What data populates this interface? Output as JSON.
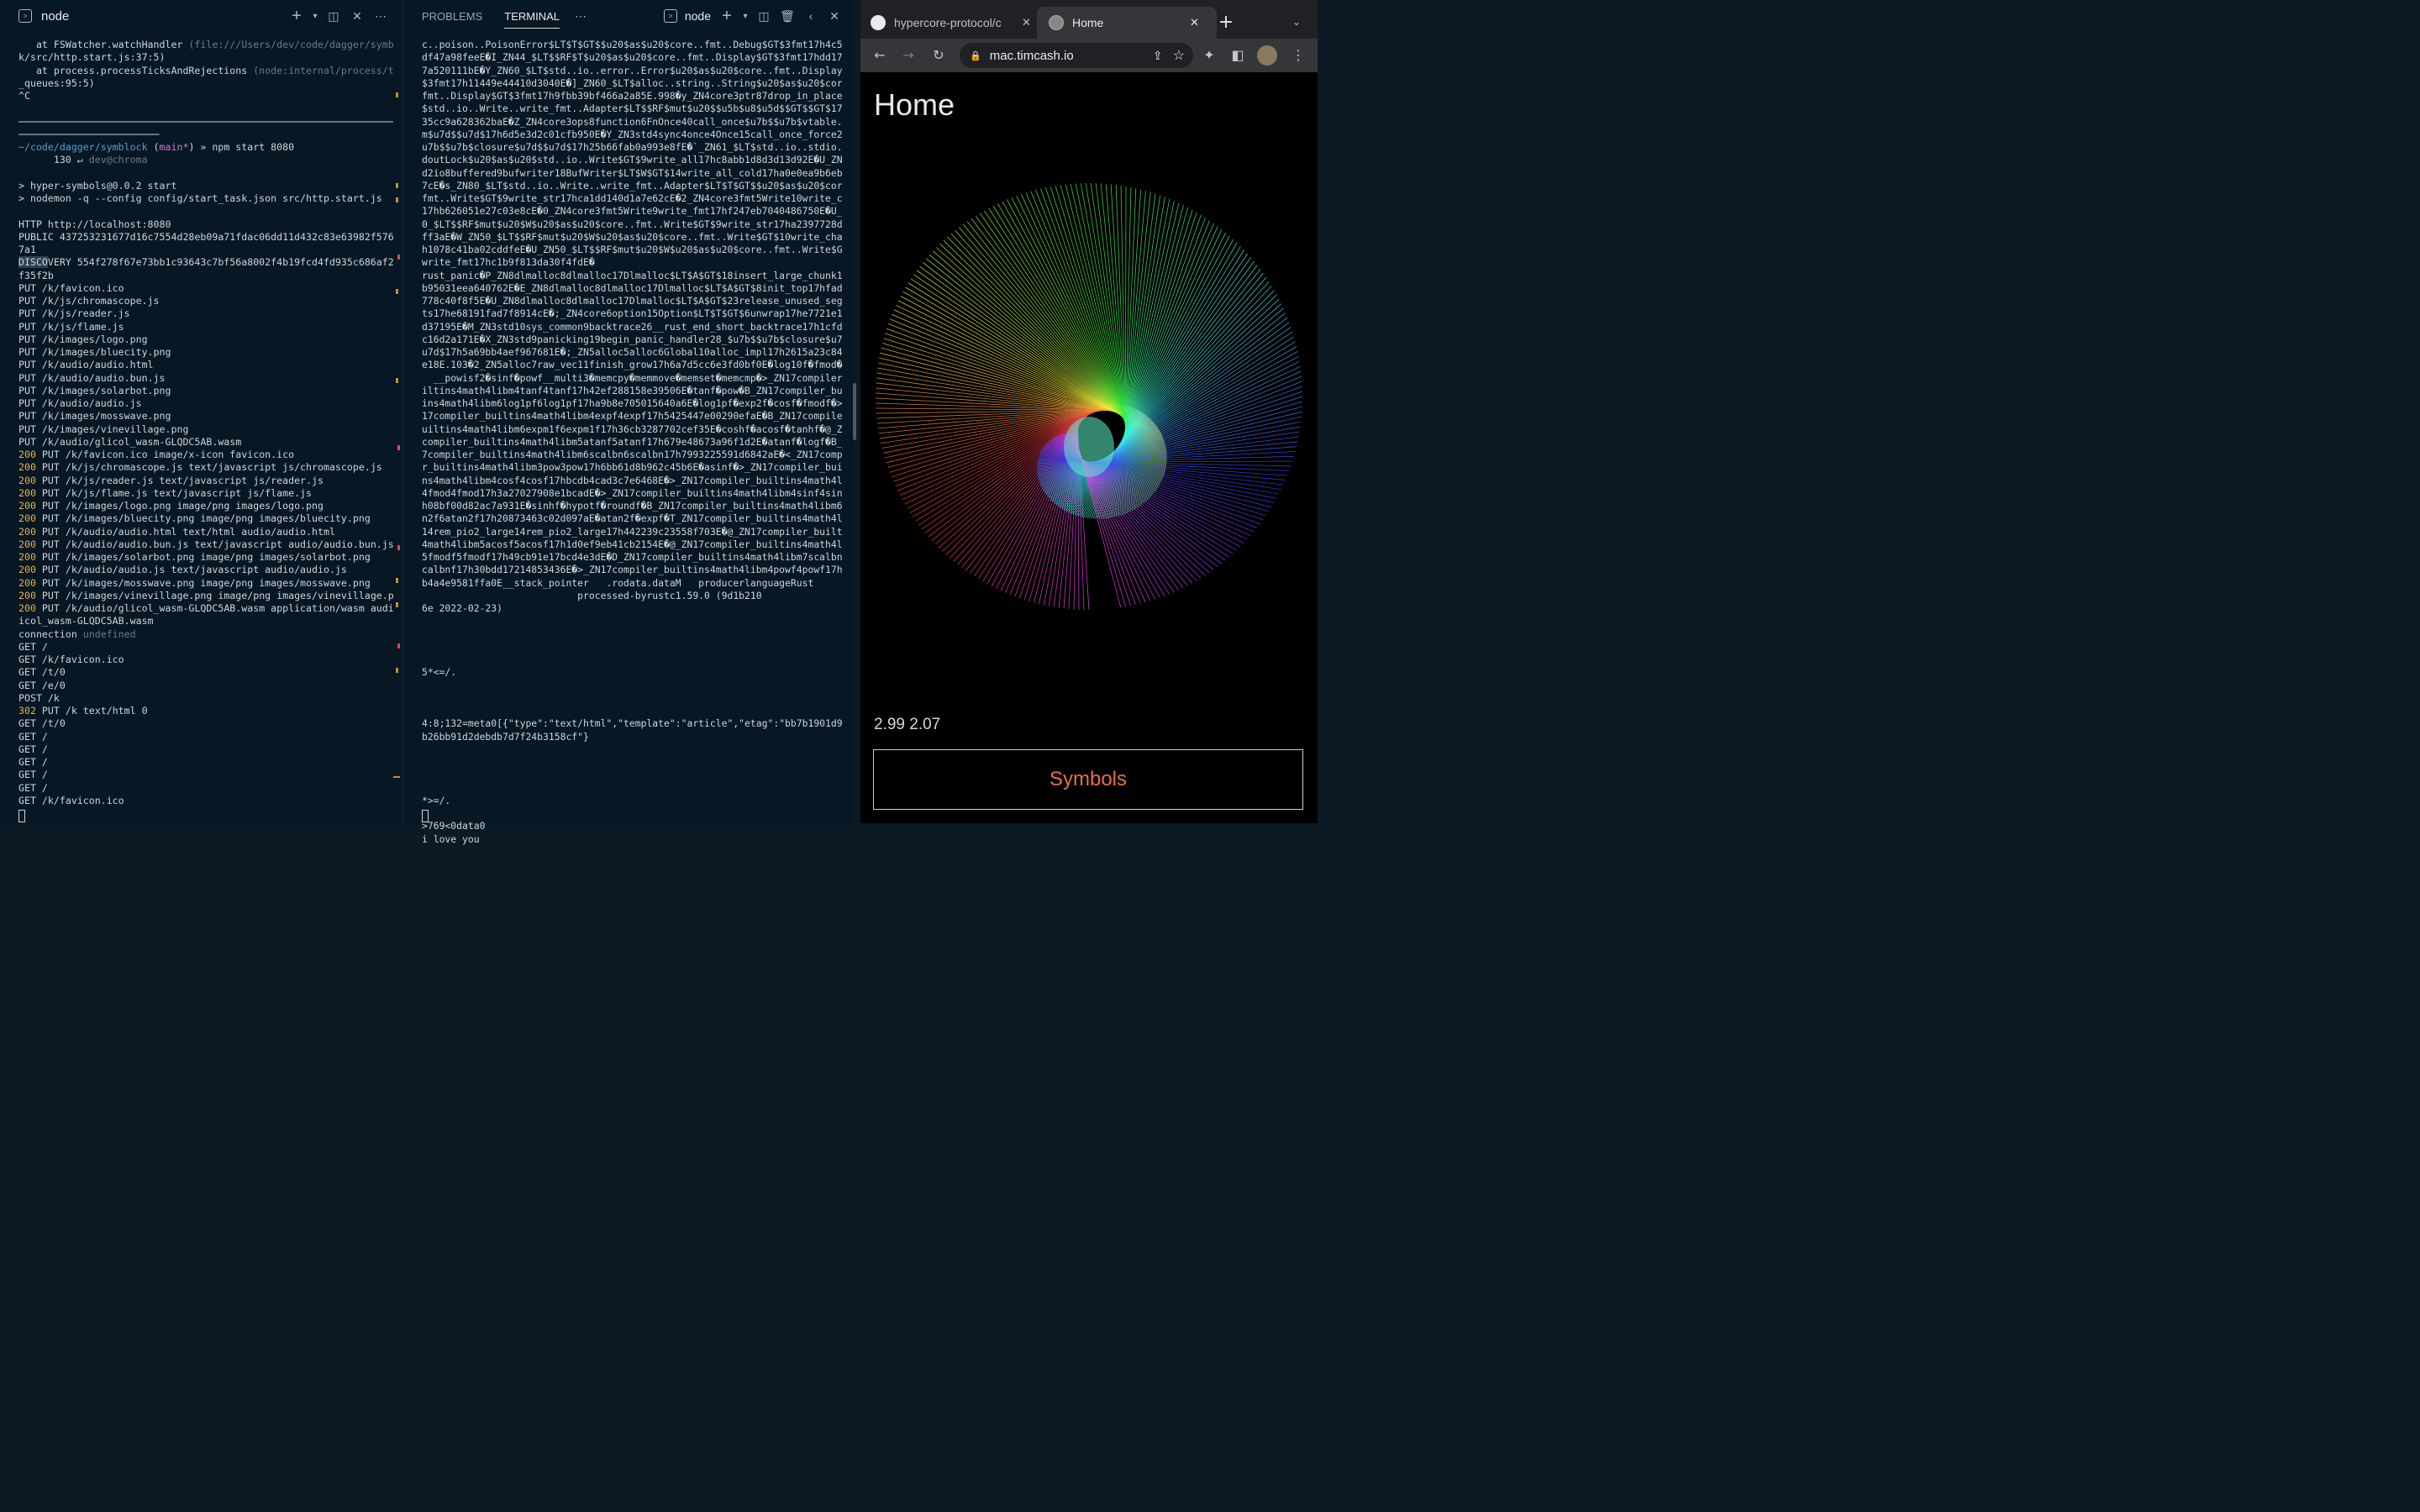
{
  "left_panel": {
    "title": "node",
    "lines": [
      {
        "t": "   at FSWatcher.watchHandler ",
        "d": "(file:///Users/dev/code/dagger/symbloc"
      },
      {
        "t": "k/src/http.start.js:37:5)",
        "d": ""
      },
      {
        "t": "   at process.processTicksAndRejections ",
        "d": "(node:internal/process/task"
      },
      {
        "t": "_queues:95:5)",
        "d": ""
      },
      {
        "t": "^C",
        "d": ""
      },
      {
        "t": "",
        "d": ""
      },
      {
        "t": "──────────────────────────────────────────────────────────────────",
        "d": ""
      },
      {
        "t": "────────────────────────",
        "d": ""
      },
      {
        "prompt": true
      },
      {
        "t": "      130 ↵ ",
        "d": "dev@chroma"
      },
      {
        "t": "",
        "d": ""
      },
      {
        "t": "> hyper-symbols@0.0.2 start",
        "d": ""
      },
      {
        "t": "> nodemon -q --config config/start_task.json src/http.start.js",
        "d": ""
      },
      {
        "t": "",
        "d": ""
      },
      {
        "t": "HTTP http://localhost:8080",
        "d": ""
      },
      {
        "t": "PUBLIC 437253231677d16c7554d28eb09a71fdac06dd11d432c83e63982f5762216",
        "d": ""
      },
      {
        "t": "7a1",
        "d": ""
      },
      {
        "sel": "DISCO",
        "t": "VERY 554f278f67e73bb1c93643c7bf56a8002f4b19fcd4fd935c686af24134",
        "d": ""
      },
      {
        "t": "f35f2b",
        "d": ""
      },
      {
        "t": "PUT /k/favicon.ico",
        "d": ""
      },
      {
        "t": "PUT /k/js/chromascope.js",
        "d": ""
      },
      {
        "t": "PUT /k/js/reader.js",
        "d": ""
      },
      {
        "t": "PUT /k/js/flame.js",
        "d": ""
      },
      {
        "t": "PUT /k/images/logo.png",
        "d": ""
      },
      {
        "t": "PUT /k/images/bluecity.png",
        "d": ""
      },
      {
        "t": "PUT /k/audio/audio.html",
        "d": ""
      },
      {
        "t": "PUT /k/audio/audio.bun.js",
        "d": ""
      },
      {
        "t": "PUT /k/images/solarbot.png",
        "d": ""
      },
      {
        "t": "PUT /k/audio/audio.js",
        "d": ""
      },
      {
        "t": "PUT /k/images/mosswave.png",
        "d": ""
      },
      {
        "t": "PUT /k/images/vinevillage.png",
        "d": ""
      },
      {
        "t": "PUT /k/audio/glicol_wasm-GLQDC5AB.wasm",
        "d": ""
      },
      {
        "ok": "200",
        "t": " PUT /k/favicon.ico image/x-icon favicon.ico",
        "d": ""
      },
      {
        "ok": "200",
        "t": " PUT /k/js/chromascope.js text/javascript js/chromascope.js",
        "d": ""
      },
      {
        "ok": "200",
        "t": " PUT /k/js/reader.js text/javascript js/reader.js",
        "d": ""
      },
      {
        "ok": "200",
        "t": " PUT /k/js/flame.js text/javascript js/flame.js",
        "d": ""
      },
      {
        "ok": "200",
        "t": " PUT /k/images/logo.png image/png images/logo.png",
        "d": ""
      },
      {
        "ok": "200",
        "t": " PUT /k/images/bluecity.png image/png images/bluecity.png",
        "d": ""
      },
      {
        "ok": "200",
        "t": " PUT /k/audio/audio.html text/html audio/audio.html",
        "d": ""
      },
      {
        "ok": "200",
        "t": " PUT /k/audio/audio.bun.js text/javascript audio/audio.bun.js",
        "d": ""
      },
      {
        "ok": "200",
        "t": " PUT /k/images/solarbot.png image/png images/solarbot.png",
        "d": ""
      },
      {
        "ok": "200",
        "t": " PUT /k/audio/audio.js text/javascript audio/audio.js",
        "d": ""
      },
      {
        "ok": "200",
        "t": " PUT /k/images/mosswave.png image/png images/mosswave.png",
        "d": ""
      },
      {
        "ok": "200",
        "t": " PUT /k/images/vinevillage.png image/png images/vinevillage.png",
        "d": ""
      },
      {
        "ok": "200",
        "t": " PUT /k/audio/glicol_wasm-GLQDC5AB.wasm application/wasm audio/gl",
        "d": ""
      },
      {
        "t": "icol_wasm-GLQDC5AB.wasm",
        "d": ""
      },
      {
        "t": "connection ",
        "d": "undefined"
      },
      {
        "t": "GET /",
        "d": ""
      },
      {
        "t": "GET /k/favicon.ico",
        "d": ""
      },
      {
        "t": "GET /t/0",
        "d": ""
      },
      {
        "t": "GET /e/0",
        "d": ""
      },
      {
        "t": "POST /k",
        "d": ""
      },
      {
        "ok": "302",
        "t": " PUT /k text/html 0",
        "d": ""
      },
      {
        "t": "GET /t/0",
        "d": ""
      },
      {
        "t": "GET /",
        "d": ""
      },
      {
        "t": "GET /",
        "d": ""
      },
      {
        "t": "GET /",
        "d": ""
      },
      {
        "t": "GET /",
        "d": ""
      },
      {
        "t": "GET /",
        "d": ""
      },
      {
        "t": "GET /k/favicon.ico",
        "d": ""
      }
    ],
    "prompt": {
      "path": "~/code/dagger/symblock",
      "branch": "main*",
      "cmd": " » npm start 8080"
    }
  },
  "mid_panel": {
    "tab_problems": "PROBLEMS",
    "tab_terminal": "TERMINAL",
    "title": "node",
    "lines": [
      "c..poison..PoisonError$LT$T$GT$$u20$as$u20$core..fmt..Debug$GT$3fmt17h4c5b8e",
      "df47a98feeE�I_ZN44_$LT$$RF$T$u20$as$u20$core..fmt..Display$GT$3fmt17hdd17c34",
      "7a520111bE�Y_ZN60_$LT$std..io..error..Error$u20$as$u20$core..fmt..Display$GT",
      "$3fmt17h11449e44410d3040E�]_ZN60_$LT$alloc..string..String$u20$as$u20$core..",
      "fmt..Display$GT$3fmt17h9fbb39bf466a2a85E.998�y_ZN4core3ptr87drop_in_place$LT",
      "$std..io..Write..write_fmt..Adapter$LT$$RF$mut$u20$$u5b$u8$u5d$$GT$$GT$17h93",
      "35cc9a628362baE�Z_ZN4core3ops8function6FnOnce40call_once$u7b$$u7b$vtable.shi",
      "m$u7d$$u7d$17h6d5e3d2c01cfb950E�Y_ZN3std4sync4once4Once15call_once_force28_$",
      "u7b$$u7b$closure$u7d$$u7d$17h25b66fab0a993e8fE�`_ZN61_$LT$std..io..stdio..St",
      "doutLock$u20$as$u20$std..io..Write$GT$9write_all17hc8abb1d8d3d13d92E�U_ZN3st",
      "d2io8buffered9bufwriter18BufWriter$LT$W$GT$14write_all_cold17ha0e0ea9b6eb2c8",
      "7cE�s_ZN80_$LT$std..io..Write..write_fmt..Adapter$LT$T$GT$$u20$as$u20$core..",
      "fmt..Write$GT$9write_str17hca1dd140d1a7e62cE�2_ZN4core3fmt5Write10write_char",
      "17hb626051e27c03e8cE�0_ZN4core3fmt5Write9write_fmt17hf247eb7040486750E�U_ZN5",
      "0_$LT$$RF$mut$u20$W$u20$as$u20$core..fmt..Write$GT$9write_str17ha2397728d726",
      "ff3aE�W_ZN50_$LT$$RF$mut$u20$W$u20$as$u20$core..fmt..Write$GT$10write_char17",
      "h1078c41ba02cddfeE�U_ZN50_$LT$$RF$mut$u20$W$u20$as$u20$core..fmt..Write$GT$9",
      "write_fmt17hc1b9f813da30f4fdE�",
      "rust_panic�P_ZN8dlmalloc8dlmalloc17Dlmalloc$LT$A$GT$18insert_large_chunk17h2",
      "b95031eea640762E�E_ZN8dlmalloc8dlmalloc17Dlmalloc$LT$A$GT$8init_top17hfadd63",
      "778c40f8f5E�U_ZN8dlmalloc8dlmalloc17Dlmalloc$LT$A$GT$23release_unused_segmen",
      "ts17he68191fad7f8914cE�;_ZN4core6option15Option$LT$T$GT$6unwrap17he7721e1eeb",
      "d37195E�M_ZN3std10sys_common9backtrace26__rust_end_short_backtrace17h1cfd7c1",
      "c16d2a171E�X_ZN3std9panicking19begin_panic_handler28_$u7b$$u7b$closure$u7d$$",
      "u7d$17h5a69bb4aef967681E�;_ZN5alloc5alloc6Global10alloc_impl17h2615a23c84f76",
      "e18E.103�2_ZN5alloc7raw_vec11finish_grow17h6a7d5cc6e3fd0bf0E�log10f�fmod�",
      "  __powisf2�sinf�powf__multi3�memcpy�memmove�memset�memcmp�>_ZN17compiler_bu",
      "iltins4math4libm4tanf4tanf17h42ef288158e39506E�tanf�pow�B_ZN17compiler_built",
      "ins4math4libm6log1pf6log1pf17ha9b8e705015640a6E�log1pf�exp2f�cosf�fmodf�>_ZN",
      "17compiler_builtins4math4libm4expf4expf17h5425447e00290efaE�B_ZN17compiler_b",
      "uiltins4math4libm6expm1f6expm1f17h36cb3287702cef35E�coshf�acosf�tanhf�@_ZN17",
      "compiler_builtins4math4libm5atanf5atanf17h679e48673a96f1d2E�atanf�logf�B_ZN1",
      "7compiler_builtins4math4libm6scalbn6scalbn17h7993225591d6842aE�<_ZN17compile",
      "r_builtins4math4libm3pow3pow17h6bb61d8b962c45b6E�asinf�>_ZN17compiler_builti",
      "ns4math4libm4cosf4cosf17hbcdb4cad3c7e6468E�>_ZN17compiler_builtins4math4libm",
      "4fmod4fmod17h3a27027908e1bcadE�>_ZN17compiler_builtins4math4libm4sinf4sinf17",
      "h08bf00d82ac7a931E�sinhf�hypotf�roundf�B_ZN17compiler_builtins4math4libm6ata",
      "n2f6atan2f17h20873463c02d097aE�atan2f�expf�T_ZN17compiler_builtins4math4libm",
      "14rem_pio2_large14rem_pio2_large17h442239c23558f703E�@_ZN17compiler_builtins",
      "4math4libm5acosf5acosf17h1d0ef9eb41cb2154E�@_ZN17compiler_builtins4math4libm",
      "5fmodf5fmodf17h49cb91e17bcd4e3dE�D_ZN17compiler_builtins4math4libm7scalbnf7s",
      "calbnf17h30bdd17214853436E�>_ZN17compiler_builtins4math4libm4powf4powf17h91c",
      "b4a4e9581ffa0E__stack_pointer   .rodata.dataM   producerlanguageRust",
      "                           processed-byrustc1.59.0 (9d1b210",
      "6e 2022-02-23)",
      "",
      "",
      "",
      "",
      "5*<=/.",
      "",
      "",
      "",
      "4:8;132=meta0[{\"type\":\"text/html\",\"template\":\"article\",\"etag\":\"bb7b1901d99e8",
      "b26bb91d2debdb7d7f24b3158cf\"}",
      "",
      "",
      "",
      "",
      "*>=/.",
      "",
      ">769<0data0",
      "i love you"
    ]
  },
  "browser": {
    "tab1_title": "hypercore-protocol/c",
    "tab2_title": "Home",
    "url": "mac.timcash.io",
    "page_title": "Home",
    "numbers": "2.99 2.07",
    "button_label": "Symbols"
  },
  "colors": {
    "terminal_bg": "#071723",
    "status_ok": "#e8b24a",
    "path": "#4ea3d9",
    "branch": "#d07bd0",
    "button_text": "#e2704a"
  }
}
